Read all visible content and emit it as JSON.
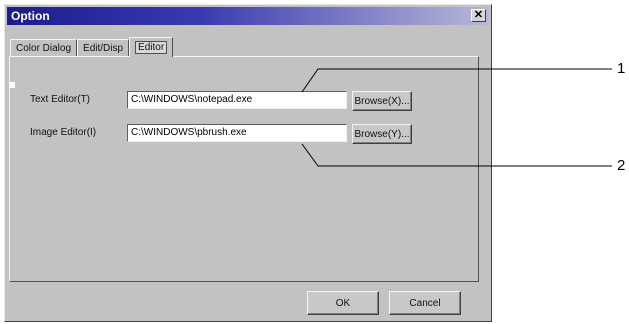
{
  "window": {
    "title": "Option",
    "close_glyph": "✕"
  },
  "tabs": [
    {
      "label": "Color Dialog"
    },
    {
      "label": "Edit/Disp"
    },
    {
      "label": "Editor",
      "active": true
    }
  ],
  "editor": {
    "text_editor_label": "Text Editor(T)",
    "text_editor_value": "C:\\WINDOWS\\notepad.exe",
    "text_browse_label": "Browse(X)...",
    "image_editor_label": "Image Editor(I)",
    "image_editor_value": "C:\\WINDOWS\\pbrush.exe",
    "image_browse_label": "Browse(Y)..."
  },
  "footer": {
    "ok_label": "OK",
    "cancel_label": "Cancel"
  },
  "callouts": [
    {
      "label": "1"
    },
    {
      "label": "2"
    }
  ]
}
